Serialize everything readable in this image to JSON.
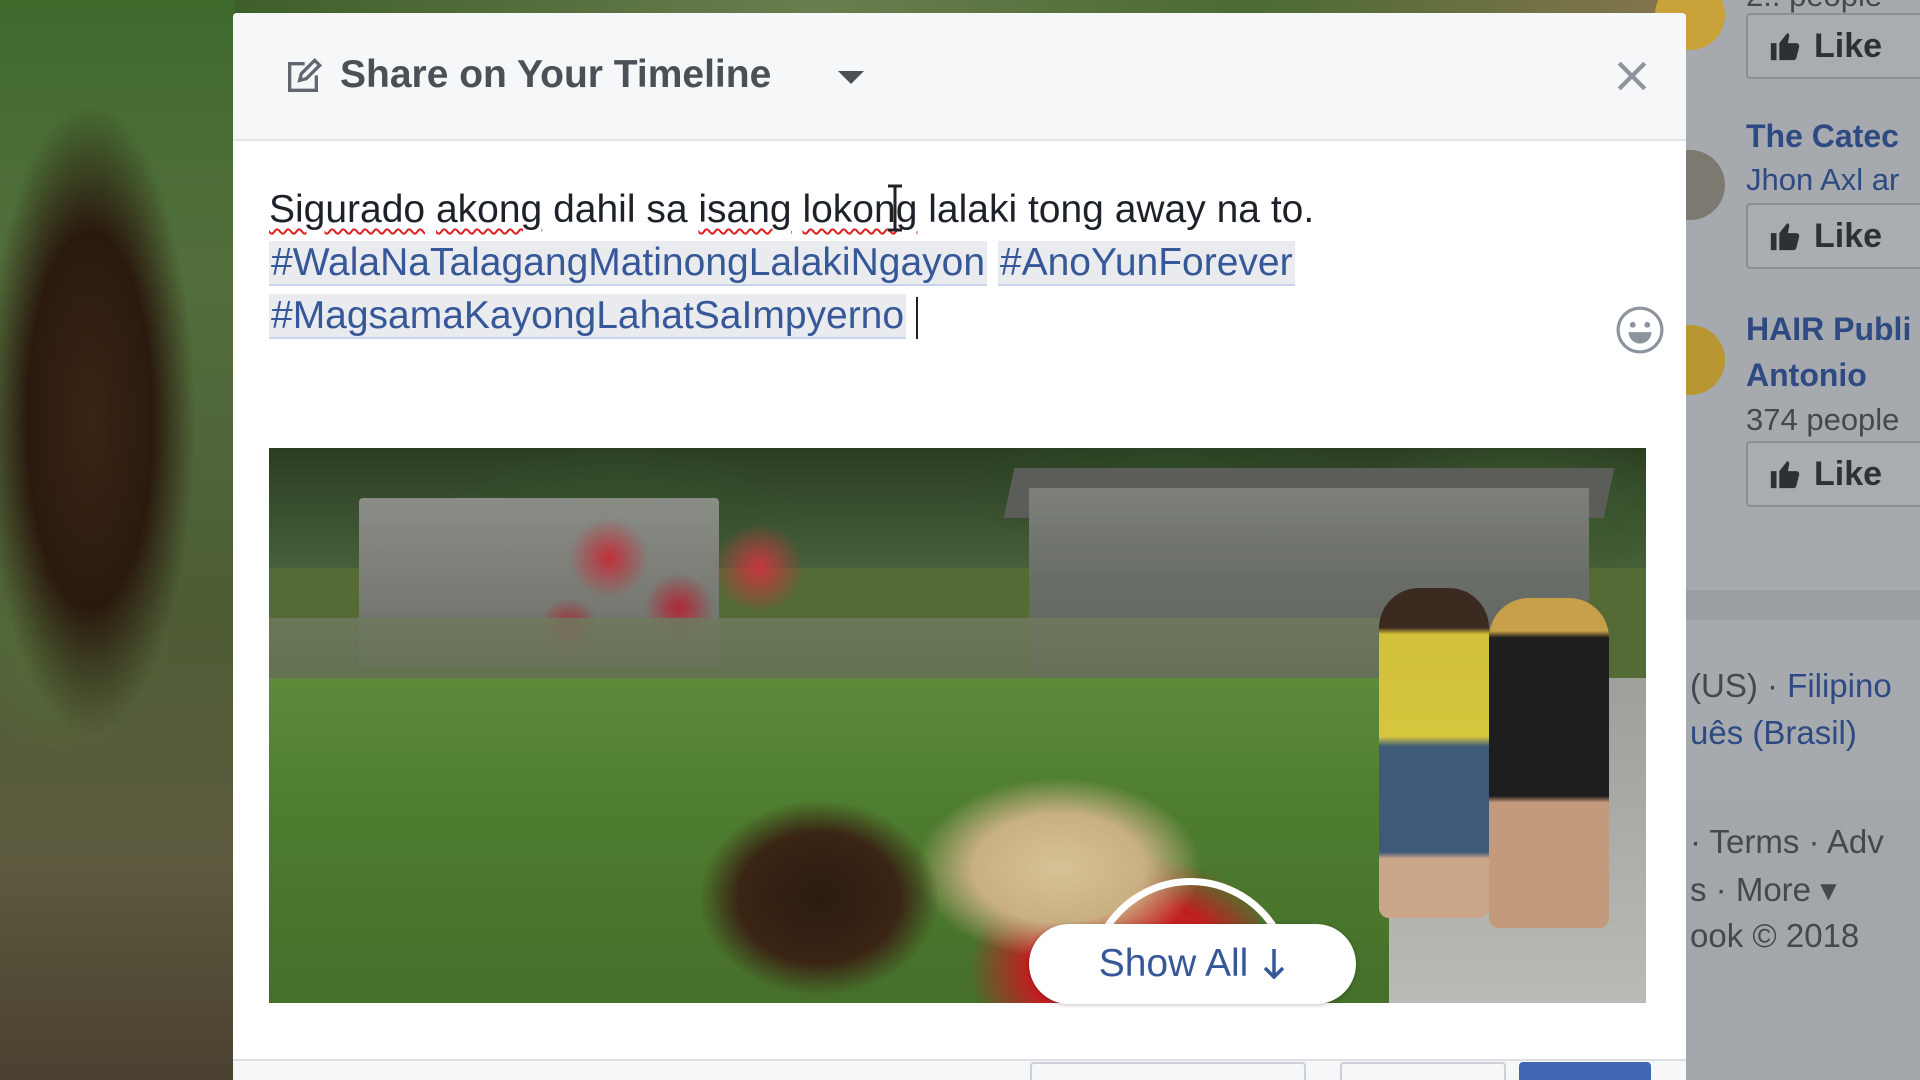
{
  "dialog": {
    "title": "Share on Your Timeline",
    "post_text": {
      "line1_words": [
        "Sigurado",
        "akong",
        "dahil",
        "sa",
        "isang",
        "lokong",
        "lalaki",
        "tong",
        "away",
        "na",
        "to."
      ],
      "hashtag1": "#WalaNaTalagangMatinongLalakiNgayon",
      "hashtag2": "#AnoYunForever",
      "hashtag3": "#MagsamaKayongLahatSaImpyerno"
    },
    "show_all_label": "Show All"
  },
  "background_sidebar": {
    "like_label": "Like",
    "pages": [
      {
        "name": "The Catec",
        "sub": "Jhon Axl ar"
      },
      {
        "name": "HAIR Publi",
        "name2": "Antonio",
        "sub": "374 people"
      }
    ],
    "top_sub": "2.. people",
    "languages_line1_prefix": "(US) · ",
    "languages_line1_link": "Filipino",
    "languages_line2": "uês (Brasil)",
    "footer_line1": "· Terms · Adv",
    "footer_line2": "s · More ▾",
    "footer_line3": "ook © 2018"
  },
  "icons": {
    "edit": "edit-icon",
    "dropdown": "caret-down-icon",
    "close": "close-icon",
    "emoji": "emoji-icon",
    "arrow": "arrow-down-icon",
    "like": "thumbs-up-icon"
  },
  "colors": {
    "fb_blue": "#365899",
    "header_bg": "#f6f7f9",
    "hashtag_bg": "#e9ebee",
    "spell_error": "#e02020"
  }
}
